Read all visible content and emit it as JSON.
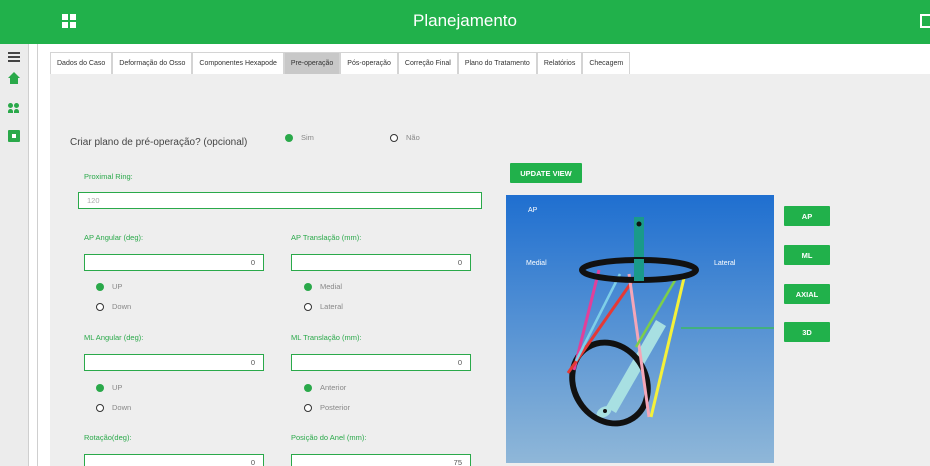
{
  "header": {
    "title": "Planejamento",
    "icon": "grid-icon",
    "exit_icon": "exit-icon"
  },
  "sidebar": {
    "icons": [
      "menu-icon",
      "home-icon",
      "people-icon",
      "box-icon"
    ]
  },
  "tabs": [
    {
      "label": "Dados do Caso",
      "active": false
    },
    {
      "label": "Deformação do Osso",
      "active": false
    },
    {
      "label": "Componentes Hexapode",
      "active": false
    },
    {
      "label": "Pre-operação",
      "active": true
    },
    {
      "label": "Pós-operação",
      "active": false
    },
    {
      "label": "Correção Final",
      "active": false
    },
    {
      "label": "Plano do Tratamento",
      "active": false
    },
    {
      "label": "Relatórios",
      "active": false
    },
    {
      "label": "Checagem",
      "active": false
    }
  ],
  "form": {
    "question": "Criar plano de pré-operação? (opcional)",
    "yes": "Sim",
    "no": "Não",
    "proximal_ring": {
      "label": "Proximal Ring:",
      "value": "120"
    },
    "ap_angular": {
      "label": "AP Angular (deg):",
      "value": "0",
      "opt1": "UP",
      "opt2": "Down"
    },
    "ap_translation": {
      "label": "AP Translação (mm):",
      "value": "0",
      "opt1": "Medial",
      "opt2": "Lateral"
    },
    "ml_angular": {
      "label": "ML Angular (deg):",
      "value": "0",
      "opt1": "UP",
      "opt2": "Down"
    },
    "ml_translation": {
      "label": "ML Translação (mm):",
      "value": "0",
      "opt1": "Anterior",
      "opt2": "Posterior"
    },
    "rotation": {
      "label": "Rotação(deg):",
      "value": "0"
    },
    "ring_position": {
      "label": "Posição do Anel (mm):",
      "value": "75"
    }
  },
  "viewer": {
    "update_label": "UPDATE VIEW",
    "label_ap": "AP",
    "label_medial": "Medial",
    "label_lateral": "Lateral",
    "view_buttons": [
      "AP",
      "ML",
      "AXIAL",
      "3D"
    ],
    "colors": {
      "background": "#2b7fcf",
      "ring": "#111111",
      "bone": "#1a9a8a",
      "struts": [
        "#e0409a",
        "#e53935",
        "#f4a6b8",
        "#7ccf4a",
        "#f4f13a",
        "#9ad6e0"
      ]
    }
  }
}
